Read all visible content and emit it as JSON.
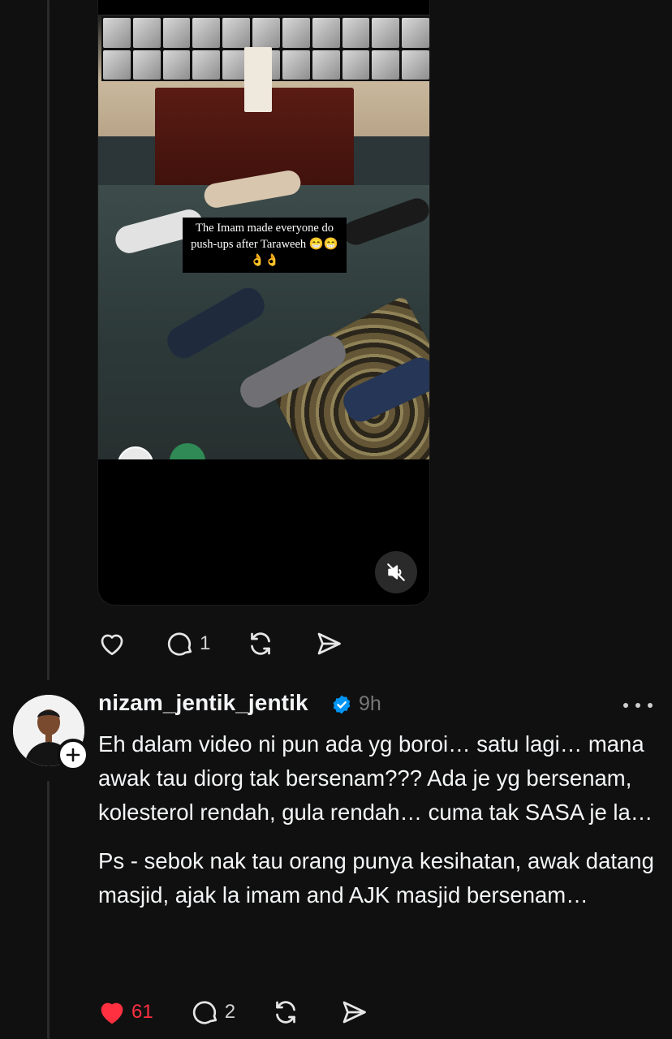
{
  "video": {
    "caption": "The Imam made everyone do push-ups after Taraweeh 😁😁👌👌",
    "muted": true
  },
  "post_actions": {
    "reply_count": "1"
  },
  "reply": {
    "username": "nizam_jentik_jentik",
    "verified": true,
    "time": "9h",
    "paragraphs": [
      "Eh dalam video ni pun ada yg boroi… satu lagi… mana awak tau diorg tak bersenam??? Ada je yg bersenam, kolesterol rendah, gula rendah… cuma tak SASA je la…",
      "Ps - sebok nak tau orang punya kesihatan, awak datang masjid, ajak la imam and AJK masjid bersenam…"
    ],
    "like_count": "61",
    "liked": true,
    "reply_count": "2"
  },
  "colors": {
    "background": "#101010",
    "like_active": "#ff3040",
    "verified_badge": "#0095f6",
    "muted_text": "#777777"
  },
  "icons": [
    "heart-icon",
    "comment-icon",
    "repost-icon",
    "share-icon",
    "mute-icon",
    "verified-badge-icon",
    "plus-icon",
    "more-icon"
  ]
}
